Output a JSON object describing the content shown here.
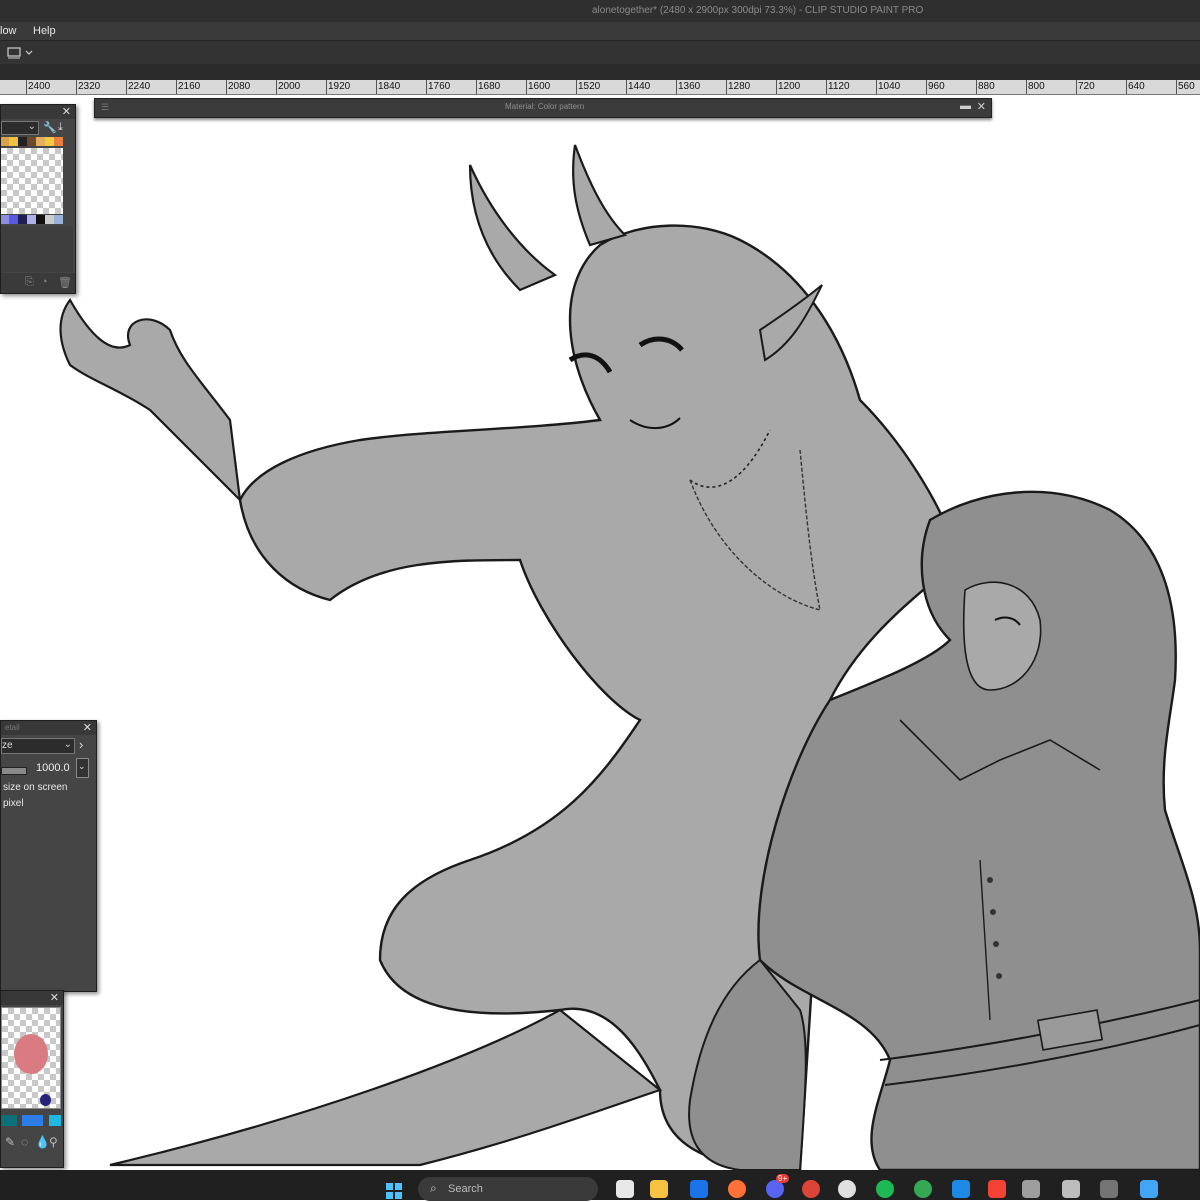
{
  "window": {
    "title": "alonetogether* (2480 x 2900px 300dpi 73.3%)  - CLIP STUDIO PAINT PRO"
  },
  "menu": {
    "items": [
      "low",
      "Help"
    ]
  },
  "ruler": {
    "labels": [
      "2400",
      "2320",
      "2240",
      "2160",
      "2080",
      "2000",
      "1920",
      "1840",
      "1760",
      "1680",
      "1600",
      "1520",
      "1440",
      "1360",
      "1280",
      "1200",
      "1120",
      "1040",
      "960",
      "880",
      "800",
      "720",
      "640",
      "560"
    ]
  },
  "material_panel": {
    "title": "Material: Color pattern"
  },
  "tool_detail": {
    "title": "etail",
    "value": "1000.0",
    "option_1": "size on screen",
    "option_2": "pixel",
    "dropdown": "ze"
  },
  "colors": {
    "panel_bg": "#454545",
    "sub_color": "#d97b80",
    "main_color": "#27237a",
    "chrome": "#2f2f2f"
  },
  "icons": {
    "taskbar": [
      "windows-start-icon",
      "search-icon",
      "file-explorer-icon",
      "folder-icon",
      "mail-icon",
      "firefox-icon",
      "discord-icon",
      "chrome-icon",
      "spotify-icon",
      "edge-icon",
      "calendar-icon",
      "notes-icon",
      "clip-studio-icon"
    ]
  },
  "taskbar": {
    "search_placeholder": "Search",
    "badge": "9+"
  }
}
